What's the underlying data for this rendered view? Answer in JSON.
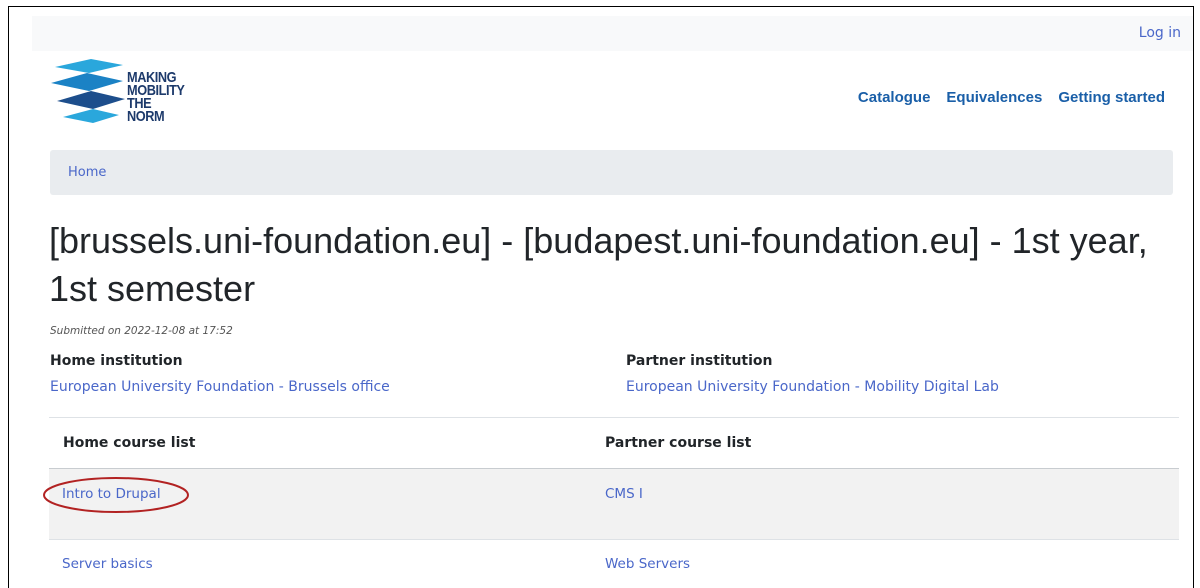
{
  "header": {
    "login_label": "Log in",
    "logo": {
      "line1": "MAKING",
      "line2": "MOBILITY",
      "line3": "THE NORM"
    },
    "nav": [
      "Catalogue",
      "Equivalences",
      "Getting started"
    ]
  },
  "breadcrumb": {
    "home": "Home"
  },
  "page": {
    "title": "[brussels.uni-foundation.eu] - [budapest.uni-foundation.eu] - 1st year, 1st semester",
    "submitted": "Submitted on 2022-12-08 at 17:52"
  },
  "institutions": {
    "home_label": "Home institution",
    "home_value": "European University Foundation - Brussels office",
    "partner_label": "Partner institution",
    "partner_value": "European University Foundation - Mobility Digital Lab"
  },
  "courses": {
    "headers": [
      "Home course list",
      "Partner course list"
    ],
    "rows": [
      {
        "home": "Intro to Drupal",
        "partner": "CMS I"
      },
      {
        "home": "Server basics",
        "partner": "Web Servers"
      }
    ]
  },
  "colors": {
    "link": "#4a67c9",
    "nav": "#1a5fa8",
    "highlight_circle": "#b22222"
  }
}
